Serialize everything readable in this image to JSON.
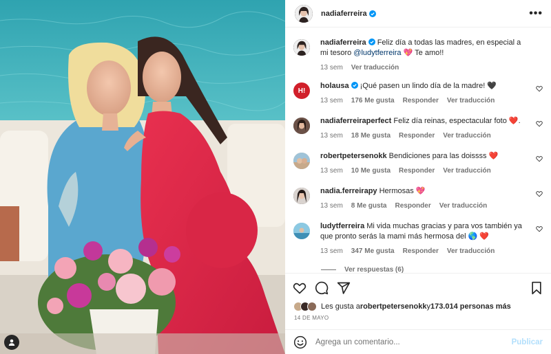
{
  "post": {
    "username": "nadiaferreira",
    "more_label": "•••"
  },
  "caption": {
    "username": "nadiaferreira",
    "text_before": " Feliz día a todas las madres, en especial a mi tesoro ",
    "mention": "@ludytferreira",
    "text_after": " 💖 Te amo!!",
    "time": "13 sem",
    "translate": "Ver traducción"
  },
  "comments": [
    {
      "username": "holausa",
      "verified": true,
      "text": " ¡Qué pasen un lindo día de la madre! 🖤",
      "time": "13 sem",
      "likes": "176 Me gusta",
      "reply": "Responder",
      "translate": "Ver traducción",
      "avatar_color": "#d11f2a",
      "avatar_text": "H!"
    },
    {
      "username": "nadiaferreiraperfect",
      "verified": false,
      "text": " Feliz día reinas, espectacular foto ❤️.",
      "time": "13 sem",
      "likes": "18 Me gusta",
      "reply": "Responder",
      "translate": "Ver traducción",
      "avatar_color": "#4a3a35"
    },
    {
      "username": "robertpetersenokk",
      "verified": false,
      "text": " Bendiciones para las doissss ❤️",
      "time": "13 sem",
      "likes": "10 Me gusta",
      "reply": "Responder",
      "translate": "Ver traducción",
      "avatar_color": "#b9a48c"
    },
    {
      "username": "nadia.ferreirapy",
      "verified": false,
      "text": " Hermosas 💖",
      "time": "13 sem",
      "likes": "8 Me gusta",
      "reply": "Responder",
      "translate": "Ver traducción",
      "avatar_color": "#3a3030"
    },
    {
      "username": "ludytferreira",
      "verified": false,
      "text": " Mi vida muchas gracias y para vos también ya que pronto serás la mami más hermosa del 🌎 ❤️",
      "time": "13 sem",
      "likes": "347 Me gusta",
      "reply": "Responder",
      "translate": "Ver traducción",
      "avatar_color": "#5fa8c8"
    }
  ],
  "view_replies": "Ver respuestas (6)",
  "likes": {
    "prefix": "Les gusta a ",
    "user": "robertpetersenokk",
    "middle": " y ",
    "count": "173.014 personas más"
  },
  "date": "14 DE MAYO",
  "comment_box": {
    "placeholder": "Agrega un comentario...",
    "publish": "Publicar"
  },
  "colors": {
    "verified": "#0095f6",
    "link": "#00376b",
    "muted": "#737373",
    "publish_disabled": "#b2dffc"
  },
  "icons": [
    "user-tag-icon",
    "more-icon",
    "verified-badge-icon",
    "heart-icon",
    "comment-icon",
    "share-icon",
    "bookmark-icon",
    "emoji-icon"
  ]
}
